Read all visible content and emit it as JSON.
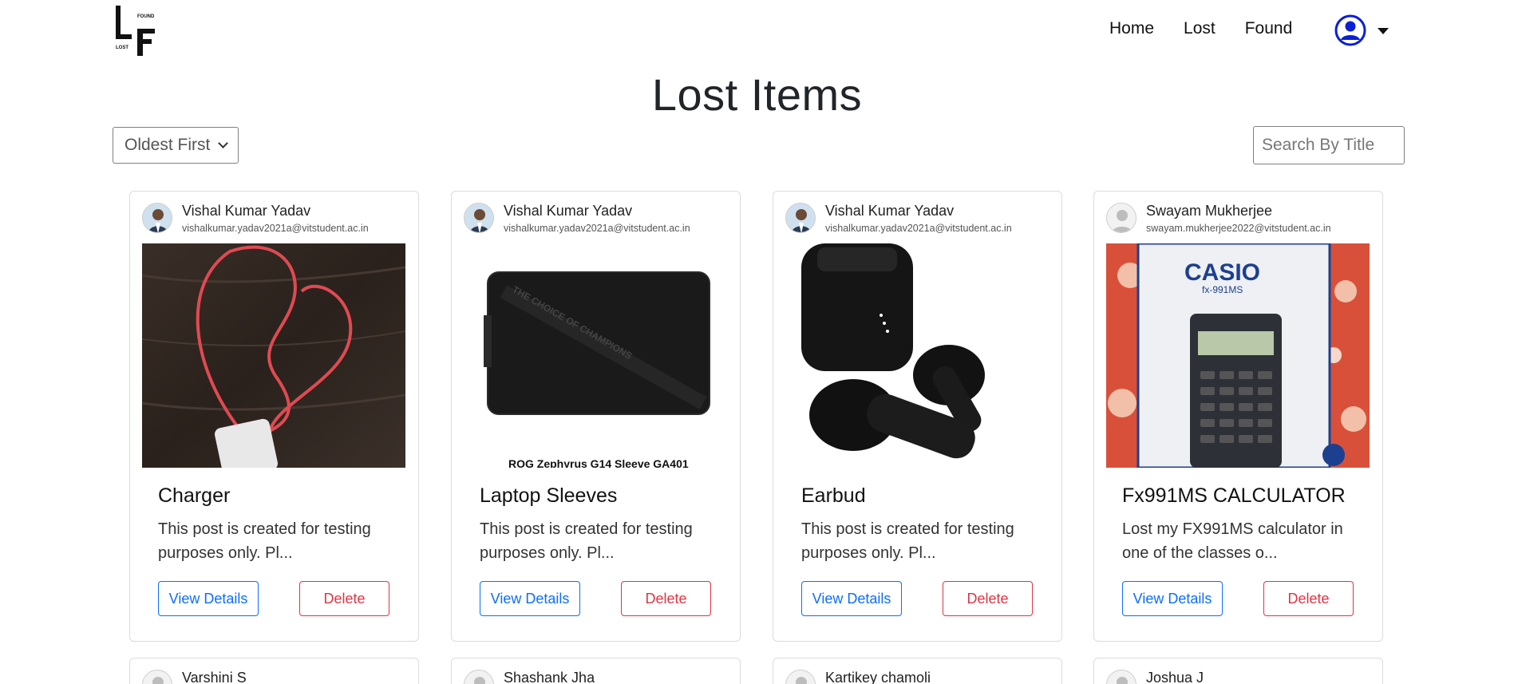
{
  "nav": {
    "logo_top_text": "FOUND",
    "logo_bottom_text": "LOST",
    "links": [
      "Home",
      "Lost",
      "Found"
    ]
  },
  "page": {
    "title": "Lost Items",
    "sort": {
      "selected": "Oldest First"
    },
    "search": {
      "placeholder": "Search By Title"
    }
  },
  "cards": [
    {
      "name": "Vishal Kumar Yadav",
      "email": "vishalkumar.yadav2021a@vitstudent.ac.in",
      "title": "Charger",
      "desc": "This post is created for testing purposes only. Pl...",
      "view_label": "View Details",
      "delete_label": "Delete"
    },
    {
      "name": "Vishal Kumar Yadav",
      "email": "vishalkumar.yadav2021a@vitstudent.ac.in",
      "title": "Laptop Sleeves",
      "desc": "This post is created for testing purposes only. Pl...",
      "image_text": "THE CHOICE OF CHAMPIONS",
      "image_caption": "ROG Zephyrus G14 Sleeve GA401",
      "view_label": "View Details",
      "delete_label": "Delete"
    },
    {
      "name": "Vishal Kumar Yadav",
      "email": "vishalkumar.yadav2021a@vitstudent.ac.in",
      "title": "Earbud",
      "desc": "This post is created for testing purposes only. Pl...",
      "view_label": "View Details",
      "delete_label": "Delete"
    },
    {
      "name": "Swayam Mukherjee",
      "email": "swayam.mukherjee2022@vitstudent.ac.in",
      "title": "Fx991MS CALCULATOR",
      "desc": "Lost my FX991MS calculator in one of the classes o...",
      "image_brand": "CASIO",
      "image_model": "fx-991MS",
      "view_label": "View Details",
      "delete_label": "Delete"
    }
  ],
  "next_row": [
    {
      "name": "Varshini S"
    },
    {
      "name": "Shashank Jha"
    },
    {
      "name": "Kartikey chamoli"
    },
    {
      "name": "Joshua J"
    }
  ],
  "colors": {
    "primary": "#0d6efd",
    "danger": "#dc3545",
    "user_icon": "#0a1fd6"
  }
}
